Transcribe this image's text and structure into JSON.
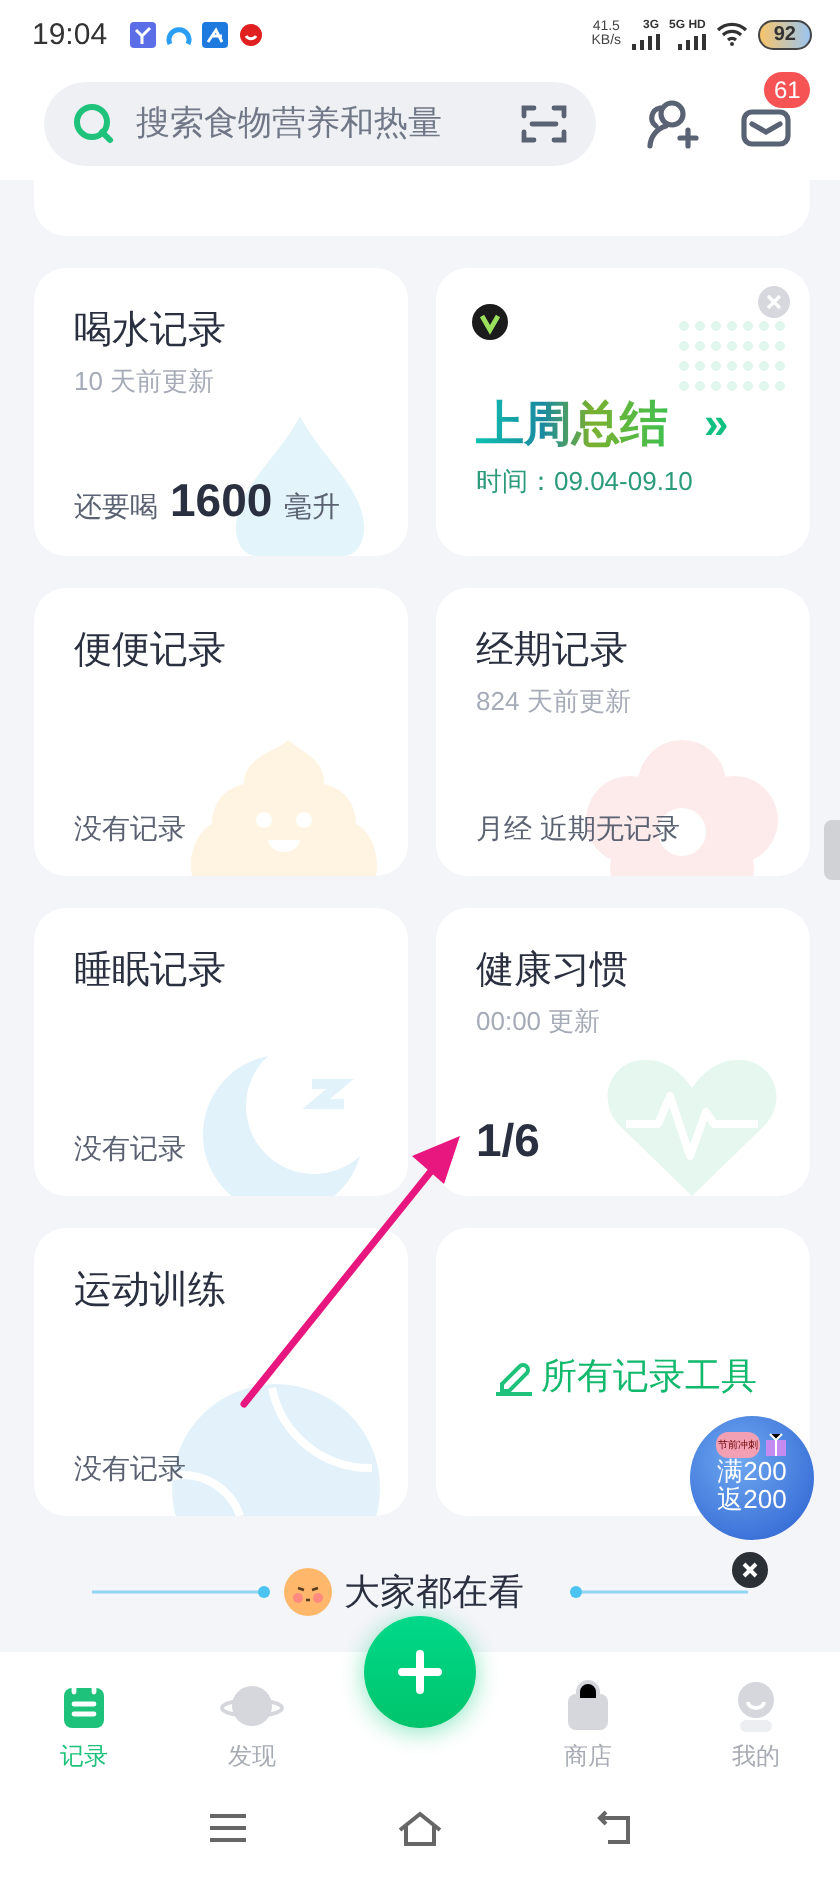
{
  "status_bar": {
    "time": "19:04",
    "net_speed": "41.5",
    "net_unit": "KB/s",
    "sim1": "3G",
    "sim2": "5G HD",
    "battery": "92"
  },
  "search": {
    "placeholder": "搜索食物营养和热量"
  },
  "messages": {
    "badge": "61"
  },
  "cards": [
    {
      "kind": "record",
      "title": "喝水记录",
      "subtitle": "10 天前更新",
      "footer_prefix": "还要喝",
      "footer_value": "1600",
      "footer_unit": "毫升"
    },
    {
      "kind": "summary",
      "title": "上周总结",
      "chevron": "»",
      "period": "时间：09.04-09.10"
    },
    {
      "kind": "record",
      "title": "便便记录",
      "footer": "没有记录"
    },
    {
      "kind": "record",
      "title": "经期记录",
      "subtitle": "824 天前更新",
      "footer": "月经 近期无记录"
    },
    {
      "kind": "record",
      "title": "睡眠记录",
      "footer": "没有记录"
    },
    {
      "kind": "record",
      "title": "健康习惯",
      "subtitle": "00:00 更新",
      "footer_value": "1/6"
    },
    {
      "kind": "record",
      "title": "运动训练",
      "footer": "没有记录"
    },
    {
      "kind": "tools",
      "title": "所有记录工具"
    }
  ],
  "promo": {
    "tag": "节前冲刺",
    "line1": "满200",
    "line2": "返200"
  },
  "section_title": "大家都在看",
  "nav": [
    {
      "label": "记录",
      "selected": true
    },
    {
      "label": "发现",
      "selected": false
    },
    {
      "label": "商店",
      "selected": false
    },
    {
      "label": "我的",
      "selected": false
    }
  ]
}
